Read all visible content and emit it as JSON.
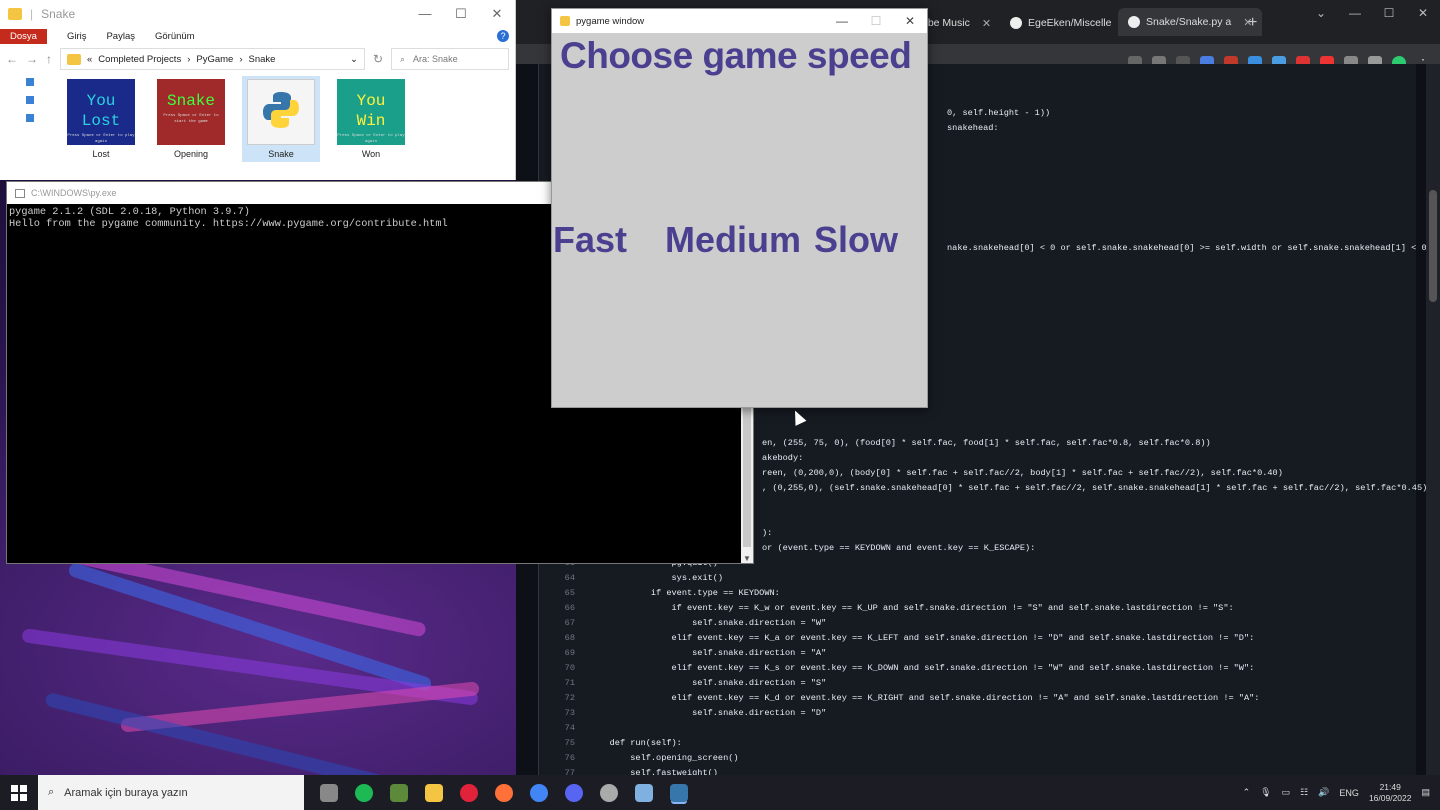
{
  "explorer": {
    "title": "Snake",
    "ribbon": [
      "Dosya",
      "Giriş",
      "Paylaş",
      "Görünüm"
    ],
    "breadcrumb": [
      "«",
      "Completed Projects",
      "›",
      "PyGame",
      "›",
      "Snake"
    ],
    "search_placeholder": "Ara: Snake",
    "files": [
      {
        "name": "Lost",
        "thumb_line1": "You",
        "thumb_line2": "Lost",
        "thumb_sub": "Press Space or Enter to play again",
        "bg": "#1a2a8a",
        "fg": "#2ad3e0"
      },
      {
        "name": "Opening",
        "thumb_line1": "Snake",
        "thumb_line2": "",
        "thumb_sub": "Press Space or Enter to start the game",
        "bg": "#a02a2a",
        "fg": "#3cff3c"
      },
      {
        "name": "Snake",
        "thumb_line1": "",
        "thumb_line2": "",
        "thumb_sub": "",
        "bg": "#f5f5f5",
        "fg": "#3776ab"
      },
      {
        "name": "Won",
        "thumb_line1": "You",
        "thumb_line2": "Win",
        "thumb_sub": "Press Space or Enter to play again",
        "bg": "#1aa08a",
        "fg": "#fff23a"
      }
    ]
  },
  "console": {
    "title": "C:\\WINDOWS\\py.exe",
    "line1": "pygame 2.1.2 (SDL 2.0.18, Python 3.9.7)",
    "line2": "Hello from the pygame community. https://www.pygame.org/contribute.html"
  },
  "browser": {
    "tabs": [
      {
        "label": "ube Music"
      },
      {
        "label": "EgeEken/Miscelle"
      },
      {
        "label": "Snake/Snake.py a"
      }
    ]
  },
  "pygame": {
    "title": "pygame window",
    "heading": "Choose game speed",
    "options": [
      "Fast",
      "Medium",
      "Slow"
    ]
  },
  "code": {
    "upper": [
      {
        "t": "0, self.height - 1))"
      },
      {
        "t": "snakehead:"
      }
    ],
    "collision": "nake.snakehead[0] < 0 or self.snake.snakehead[0] >= self.width or self.snake.snakehead[1] < 0 or",
    "draw": [
      "en, (255, 75, 0), (food[0] * self.fac, food[1] * self.fac, self.fac*0.8, self.fac*0.8))",
      "akebody:",
      "reen, (0,200,0), (body[0] * self.fac + self.fac//2, body[1] * self.fac + self.fac//2), self.fac*0.40)",
      ", (0,255,0), (self.snake.snakehead[0] * self.fac + self.fac//2, self.snake.snakehead[1] * self.fac + self.fac//2), self.fac*0.45)"
    ],
    "events_partial": [
      "):",
      "or (event.type == KEYDOWN and event.key == K_ESCAPE):"
    ],
    "lines": [
      {
        "n": "63",
        "c": "                pg.quit()"
      },
      {
        "n": "64",
        "c": "                sys.exit()"
      },
      {
        "n": "65",
        "c": "            if event.type == KEYDOWN:"
      },
      {
        "n": "66",
        "c": "                if event.key == K_w or event.key == K_UP and self.snake.direction != \"S\" and self.snake.lastdirection != \"S\":"
      },
      {
        "n": "67",
        "c": "                    self.snake.direction = \"W\""
      },
      {
        "n": "68",
        "c": "                elif event.key == K_a or event.key == K_LEFT and self.snake.direction != \"D\" and self.snake.lastdirection != \"D\":"
      },
      {
        "n": "69",
        "c": "                    self.snake.direction = \"A\""
      },
      {
        "n": "70",
        "c": "                elif event.key == K_s or event.key == K_DOWN and self.snake.direction != \"W\" and self.snake.lastdirection != \"W\":"
      },
      {
        "n": "71",
        "c": "                    self.snake.direction = \"S\""
      },
      {
        "n": "72",
        "c": "                elif event.key == K_d or event.key == K_RIGHT and self.snake.direction != \"A\" and self.snake.lastdirection != \"A\":"
      },
      {
        "n": "73",
        "c": "                    self.snake.direction = \"D\""
      },
      {
        "n": "74",
        "c": ""
      },
      {
        "n": "75",
        "c": "    def run(self):"
      },
      {
        "n": "76",
        "c": "        self.opening_screen()"
      },
      {
        "n": "77",
        "c": "        self.fastweight()"
      }
    ]
  },
  "taskbar": {
    "search_placeholder": "Aramak için buraya yazın",
    "lang": "ENG",
    "time": "21:49",
    "date": "16/09/2022"
  }
}
